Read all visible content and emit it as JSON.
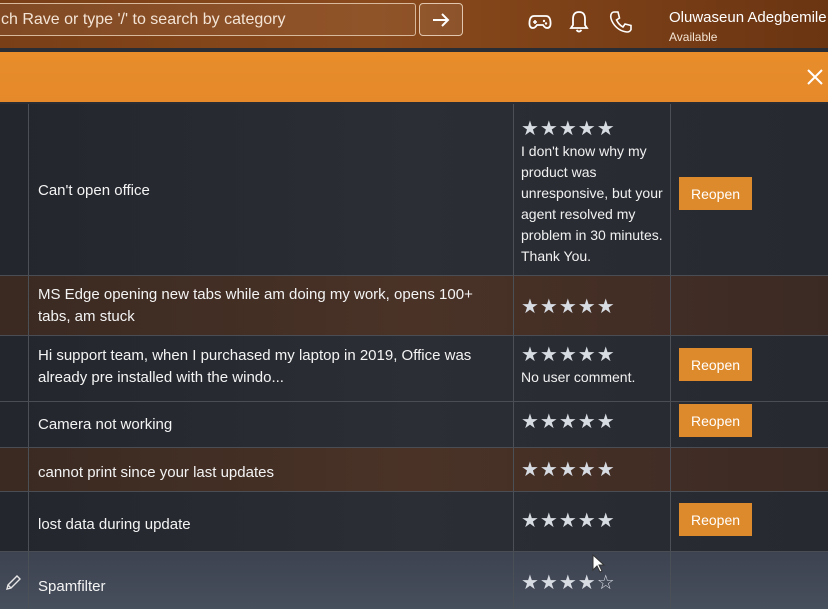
{
  "search": {
    "placeholder_text": "ch Rave or type '/' to search by category"
  },
  "header": {
    "icons": [
      "gamepad-icon",
      "bell-icon",
      "phone-icon",
      "arrow-right-icon"
    ],
    "user_name": "Oluwaseun Adegbemile",
    "user_status": "Available"
  },
  "banner": {
    "close_icon": "close-icon"
  },
  "rows": [
    {
      "title": "Can't open office",
      "rating": 5,
      "stars": "★★★★★",
      "comment": "I don't know why my product was unresponsive, but your agent resolved my problem in 30 minutes. Thank You.",
      "action": "Reopen"
    },
    {
      "title": "MS Edge opening new tabs while am doing my work, opens 100+ tabs, am stuck",
      "rating": 5,
      "stars": "★★★★★",
      "comment": "",
      "action": ""
    },
    {
      "title": "Hi support team, when I purchased my laptop in 2019, Office was already pre installed with the windo...",
      "rating": 5,
      "stars": "★★★★★",
      "comment": "No user comment.",
      "action": "Reopen"
    },
    {
      "title": "Camera not working",
      "rating": 5,
      "stars": "★★★★★",
      "comment": "",
      "action": "Reopen"
    },
    {
      "title": "cannot print since your last updates",
      "rating": 5,
      "stars": "★★★★★",
      "comment": "",
      "action": ""
    },
    {
      "title": "lost data during update",
      "rating": 5,
      "stars": "★★★★★",
      "comment": "",
      "action": "Reopen"
    },
    {
      "title": "Spamfilter",
      "rating": 4,
      "stars": "★★★★☆",
      "comment": "",
      "action": ""
    }
  ],
  "colors": {
    "accent": "#e88d2a",
    "button": "#dd8a2c",
    "topbar": "#7a3f17"
  }
}
